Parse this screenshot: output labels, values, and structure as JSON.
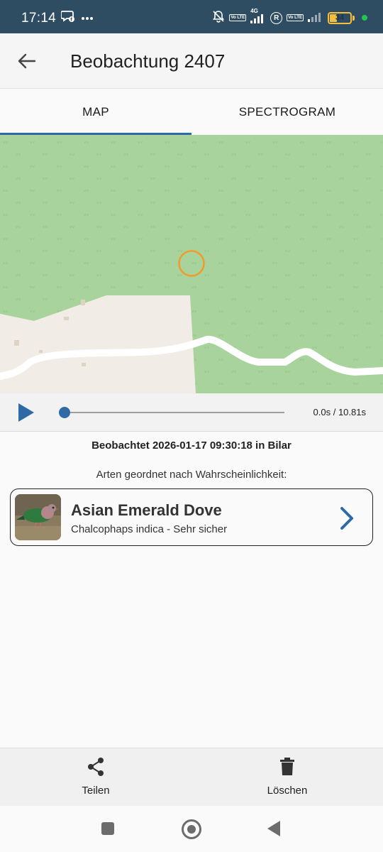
{
  "status_bar": {
    "time": "17:14",
    "battery_level": 34,
    "battery_text": "34",
    "network": "4G",
    "volte_label_1": "Vo LTE",
    "volte_label_2": "Vo LTE",
    "roaming_label": "R",
    "icons": [
      "chat-notification-icon",
      "more-dots-icon",
      "silent-bell-icon",
      "signal-icon",
      "roaming-icon",
      "battery-icon",
      "active-dot-icon"
    ]
  },
  "app_bar": {
    "title": "Beobachtung 2407",
    "back_icon": "arrow-back-icon"
  },
  "tabs": [
    {
      "label": "MAP",
      "selected": true
    },
    {
      "label": "SPECTROGRAM",
      "selected": false
    }
  ],
  "map": {
    "land_color": "#a9d39c",
    "cleared_color": "#f1ede6",
    "road_color": "#ffffff",
    "marker_color": "#f29b2b"
  },
  "player": {
    "play_icon": "play-icon",
    "progress": 0.0,
    "time_readout": "0.0s / 10.81s",
    "accent": "#2f6aa6"
  },
  "observation": {
    "observed_text": "Beobachtet 2026-01-17 09:30:18 in Bilar",
    "species_heading": "Arten geordnet nach Wahrscheinlichkeit:"
  },
  "species": [
    {
      "common_name": "Asian Emerald Dove",
      "subtitle": "Chalcophaps indica - Sehr sicher",
      "chevron_icon": "chevron-right-icon"
    }
  ],
  "actions": {
    "share_label": "Teilen",
    "delete_label": "Löschen"
  },
  "system_nav": {
    "icons": [
      "recents-icon",
      "home-icon",
      "back-icon"
    ]
  }
}
